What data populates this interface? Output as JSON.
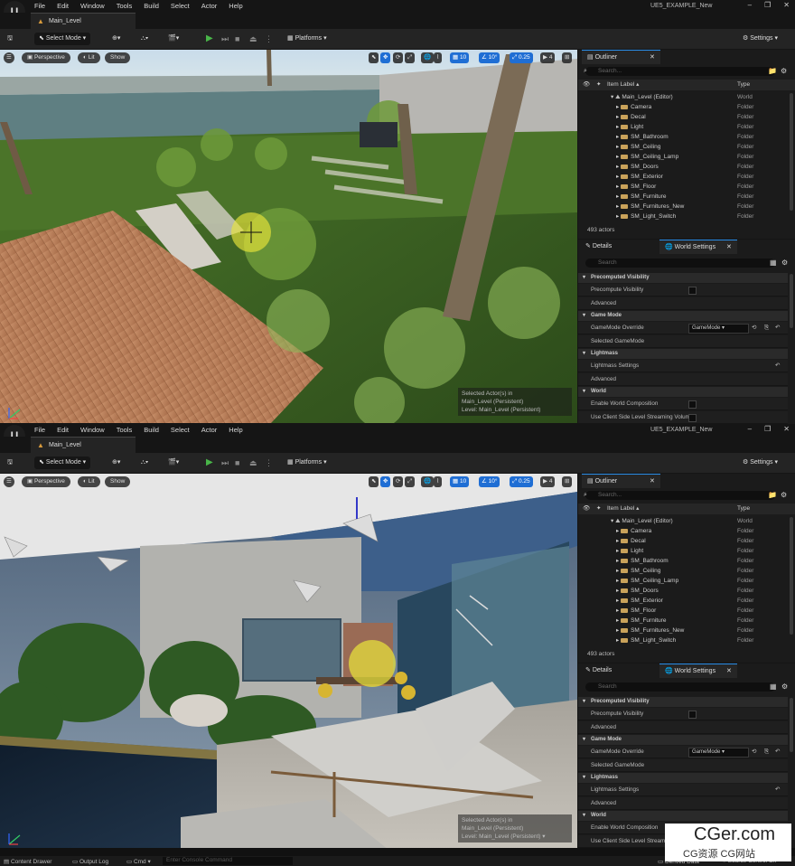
{
  "menu": [
    "File",
    "Edit",
    "Window",
    "Tools",
    "Build",
    "Select",
    "Actor",
    "Help"
  ],
  "project_name": "UE5_EXAMPLE_New",
  "level_tab": "Main_Level",
  "toolbar": {
    "select_mode": "Select Mode",
    "platforms": "Platforms",
    "settings": "Settings"
  },
  "viewport_top": {
    "perspective": "Perspective",
    "lit": "Lit",
    "show": "Show",
    "grid_snap": "10",
    "rot_snap": "10°",
    "scale_snap": "0.25",
    "cam_speed": "4",
    "selected_line1": "Selected Actor(s) in",
    "selected_line2": "Main_Level (Persistent)",
    "level_label": "Level: Main_Level (Persistent)"
  },
  "viewport_bottom": {
    "perspective": "Perspective",
    "lit": "Lit",
    "show": "Show",
    "grid_snap": "10",
    "rot_snap": "10°",
    "scale_snap": "0.25",
    "cam_speed": "4",
    "selected_line1": "Selected Actor(s) in",
    "selected_line2": "Main_Level (Persistent)",
    "level_label": "Level: Main_Level (Persistent)"
  },
  "outliner": {
    "title": "Outliner",
    "search_placeholder": "Search...",
    "col_label": "Item Label ▴",
    "col_type": "Type",
    "root_name": "Main_Level (Editor)",
    "root_type": "World",
    "items": [
      {
        "name": "Camera",
        "type": "Folder"
      },
      {
        "name": "Decal",
        "type": "Folder"
      },
      {
        "name": "Light",
        "type": "Folder"
      },
      {
        "name": "SM_Bathroom",
        "type": "Folder"
      },
      {
        "name": "SM_Ceiling",
        "type": "Folder"
      },
      {
        "name": "SM_Ceiling_Lamp",
        "type": "Folder"
      },
      {
        "name": "SM_Doors",
        "type": "Folder"
      },
      {
        "name": "SM_Exterior",
        "type": "Folder"
      },
      {
        "name": "SM_Floor",
        "type": "Folder"
      },
      {
        "name": "SM_Furniture",
        "type": "Folder"
      },
      {
        "name": "SM_Furnitures_New",
        "type": "Folder"
      },
      {
        "name": "SM_Light_Switch",
        "type": "Folder"
      }
    ],
    "actor_count": "493 actors"
  },
  "details": {
    "tab_details": "Details",
    "tab_world": "World Settings",
    "search_placeholder": "Search",
    "rows": [
      {
        "kind": "sec",
        "label": "Precomputed Visibility"
      },
      {
        "kind": "chk",
        "label": "Precompute Visibility"
      },
      {
        "kind": "prop",
        "label": "Advanced"
      },
      {
        "kind": "sec",
        "label": "Game Mode"
      },
      {
        "kind": "dd",
        "label": "GameMode Override",
        "value": "GameMode"
      },
      {
        "kind": "prop",
        "label": "Selected GameMode"
      },
      {
        "kind": "sec",
        "label": "Lightmass"
      },
      {
        "kind": "prop",
        "label": "Lightmass Settings"
      },
      {
        "kind": "prop",
        "label": "Advanced"
      },
      {
        "kind": "sec",
        "label": "World"
      },
      {
        "kind": "chk",
        "label": "Enable World Composition"
      },
      {
        "kind": "chk",
        "label": "Use Client Side Level Streaming Volumes"
      }
    ]
  },
  "statusbar": {
    "content_drawer": "Content Drawer",
    "output_log": "Output Log",
    "cmd": "Cmd",
    "console_placeholder": "Enter Console Command",
    "derived_data": "Derived Data",
    "source_control": "Source Control Off"
  },
  "watermark": {
    "line1": "CGer.com",
    "line2": "CG资源 CG网站"
  }
}
